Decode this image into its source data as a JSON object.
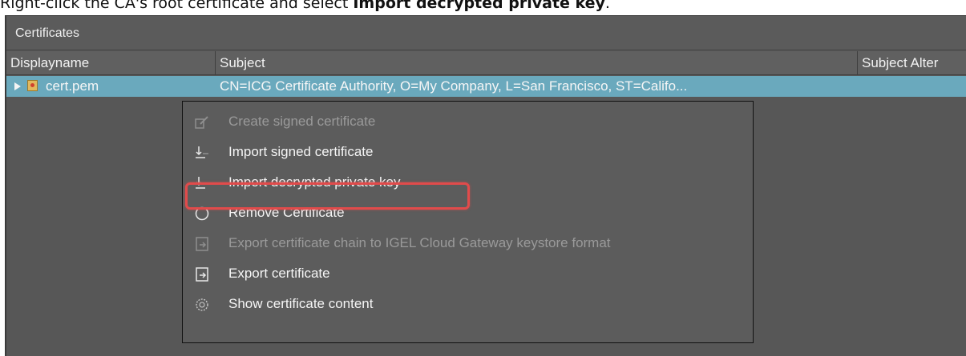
{
  "instruction": {
    "prefix": "Right-click the CA's root certificate and select ",
    "bold": "Import decrypted private key",
    "suffix": "."
  },
  "panel": {
    "title": "Certificates"
  },
  "columns": [
    "Displayname",
    "Subject",
    "Subject Alter"
  ],
  "row": {
    "name": "cert.pem",
    "subject": "CN=ICG Certificate Authority, O=My Company, L=San Francisco, ST=Califo..."
  },
  "context_menu": {
    "items": [
      {
        "label": "Create signed certificate",
        "enabled": false,
        "icon": "signed-cert-icon"
      },
      {
        "label": "Import signed certificate",
        "enabled": true,
        "icon": "import-icon"
      },
      {
        "label": "Import decrypted private key",
        "enabled": true,
        "icon": "import-key-icon",
        "highlighted": true
      },
      {
        "label": "Remove Certificate",
        "enabled": true,
        "icon": "remove-icon"
      },
      {
        "label": "Export certificate chain to IGEL Cloud Gateway keystore format",
        "enabled": false,
        "icon": "export-chain-icon"
      },
      {
        "label": "Export certificate",
        "enabled": true,
        "icon": "export-icon"
      },
      {
        "label": "Show certificate content",
        "enabled": true,
        "icon": "show-content-icon"
      }
    ]
  },
  "colors": {
    "panel_bg": "#575757",
    "selection": "#6aa9bd",
    "highlight_border": "#e14b4b"
  }
}
